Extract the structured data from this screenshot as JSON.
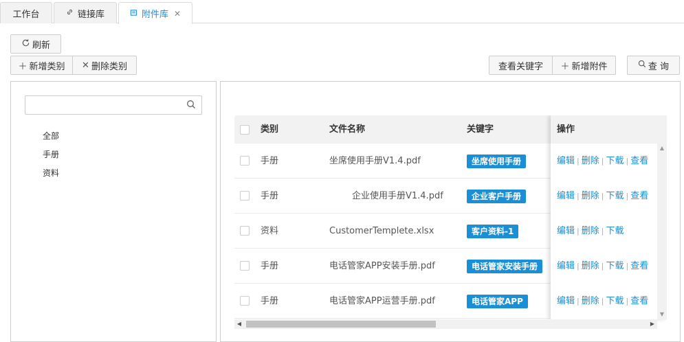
{
  "tabs": [
    {
      "label": "工作台",
      "icon": ""
    },
    {
      "label": "链接库",
      "icon": "link-icon"
    },
    {
      "label": "附件库",
      "icon": "document-icon",
      "closable": true
    }
  ],
  "toolbar": {
    "refresh": "刷新",
    "add_category": "新增类别",
    "delete_category": "删除类别",
    "view_keyword": "查看关键字",
    "add_attachment": "新增附件",
    "query": "查 询"
  },
  "tree": {
    "search_placeholder": "",
    "items": [
      "全部",
      "手册",
      "资料"
    ]
  },
  "table": {
    "headers": {
      "category": "类别",
      "filename": "文件名称",
      "keyword": "关键字",
      "actions": "操作"
    },
    "rows": [
      {
        "category": "手册",
        "filename": "坐席使用手册V1.4.pdf",
        "keyword": "坐席使用手册",
        "actions": [
          "编辑",
          "删除",
          "下载",
          "查看"
        ]
      },
      {
        "category": "手册",
        "filename": "企业使用手册V1.4.pdf",
        "keyword": "企业客户手册",
        "actions": [
          "编辑",
          "删除",
          "下载",
          "查看"
        ]
      },
      {
        "category": "资料",
        "filename": "CustomerTemplete.xlsx",
        "keyword": "客户资料-1",
        "actions": [
          "编辑",
          "删除",
          "下载"
        ]
      },
      {
        "category": "手册",
        "filename": "电话管家APP安装手册.pdf",
        "keyword": "电话管家安装手册",
        "actions": [
          "编辑",
          "删除",
          "下载",
          "查看"
        ]
      },
      {
        "category": "手册",
        "filename": "电话管家APP运营手册.pdf",
        "keyword": "电话管家APP",
        "actions": [
          "编辑",
          "删除",
          "下载",
          "查看"
        ]
      }
    ]
  },
  "colors": {
    "accent": "#1a8fd6"
  }
}
